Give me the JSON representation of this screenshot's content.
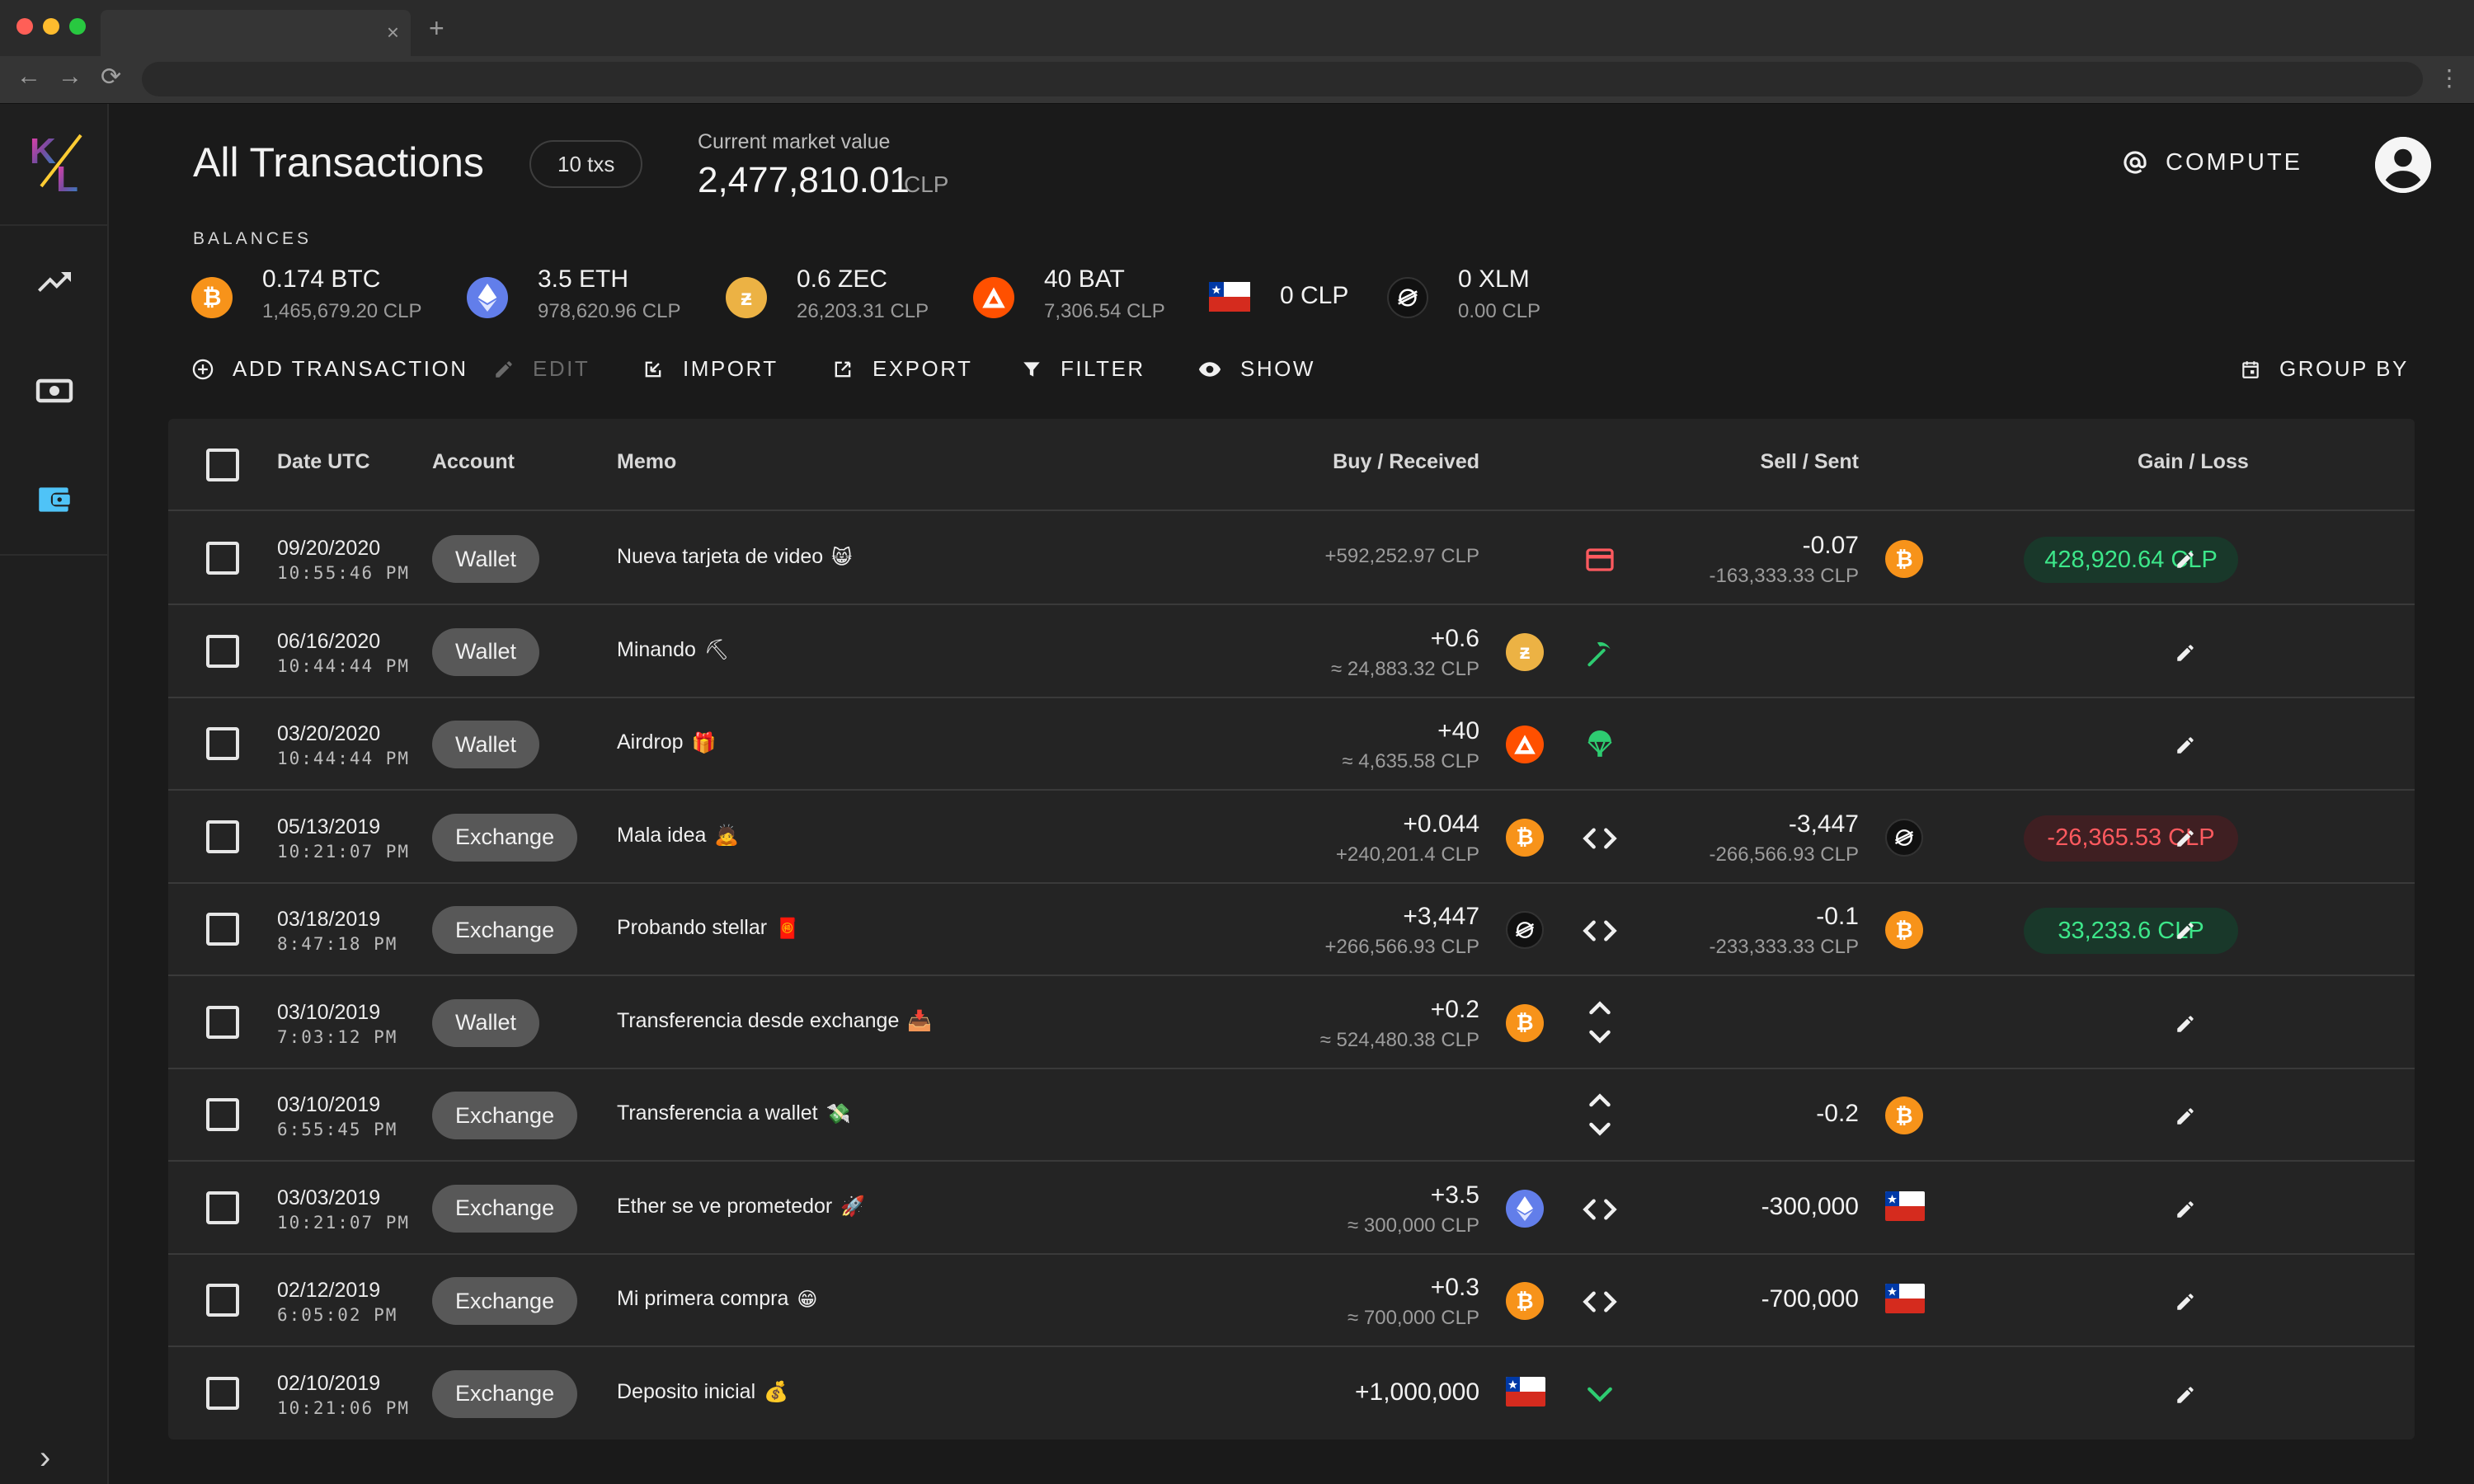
{
  "browser": {
    "tab_close": "×",
    "new_tab": "+",
    "back": "←",
    "forward": "→",
    "reload": "⟳",
    "menu": "⋮"
  },
  "sidebar": {
    "logo_letters": [
      "K",
      "L"
    ],
    "items": [
      {
        "name": "trending-icon"
      },
      {
        "name": "cash-icon"
      },
      {
        "name": "wallet-icon",
        "active_color": "#4fc3f7"
      }
    ],
    "expand": "›"
  },
  "header": {
    "title": "All Transactions",
    "tx_count": "10 txs",
    "market_value_label": "Current market value",
    "market_value": "2,477,810.01",
    "market_value_currency": "CLP",
    "compute_label": "COMPUTE"
  },
  "balances": {
    "label": "BALANCES",
    "items": [
      {
        "asset": "btc",
        "amount": "0.174 BTC",
        "value": "1,465,679.20 CLP"
      },
      {
        "asset": "eth",
        "amount": "3.5 ETH",
        "value": "978,620.96 CLP"
      },
      {
        "asset": "zec",
        "amount": "0.6 ZEC",
        "value": "26,203.31 CLP"
      },
      {
        "asset": "bat",
        "amount": "40 BAT",
        "value": "7,306.54 CLP"
      },
      {
        "asset": "clp",
        "amount": "0 CLP",
        "value": ""
      },
      {
        "asset": "xlm",
        "amount": "0 XLM",
        "value": "0.00 CLP"
      }
    ]
  },
  "toolbar": {
    "add": "ADD TRANSACTION",
    "edit": "EDIT",
    "import": "IMPORT",
    "export": "EXPORT",
    "filter": "FILTER",
    "show": "SHOW",
    "group_by": "GROUP BY"
  },
  "table": {
    "columns": {
      "date": "Date UTC",
      "account": "Account",
      "memo": "Memo",
      "buy": "Buy / Received",
      "sell": "Sell / Sent",
      "gain": "Gain / Loss"
    },
    "rows": [
      {
        "date": "09/20/2020",
        "time": "10:55:46 PM",
        "account": "Wallet",
        "memo": "Nueva tarjeta de video",
        "emoji": "😸",
        "buy_main": "",
        "buy_sub": "+592,252.97 CLP",
        "buy_asset": "",
        "kind": "card",
        "sell_main": "-0.07",
        "sell_sub": "-163,333.33 CLP",
        "sell_asset": "btc",
        "gain": "428,920.64 CLP",
        "gain_type": "pos"
      },
      {
        "date": "06/16/2020",
        "time": "10:44:44 PM",
        "account": "Wallet",
        "memo": "Minando",
        "emoji": "⛏",
        "buy_main": "+0.6",
        "buy_sub": "≈ 24,883.32 CLP",
        "buy_asset": "zec",
        "kind": "mining",
        "sell_main": "",
        "sell_sub": "",
        "sell_asset": "",
        "gain": "",
        "gain_type": ""
      },
      {
        "date": "03/20/2020",
        "time": "10:44:44 PM",
        "account": "Wallet",
        "memo": "Airdrop",
        "emoji": "🎁",
        "buy_main": "+40",
        "buy_sub": "≈ 4,635.58 CLP",
        "buy_asset": "bat",
        "kind": "airdrop",
        "sell_main": "",
        "sell_sub": "",
        "sell_asset": "",
        "gain": "",
        "gain_type": ""
      },
      {
        "date": "05/13/2019",
        "time": "10:21:07 PM",
        "account": "Exchange",
        "memo": "Mala idea",
        "emoji": "🙇",
        "buy_main": "+0.044",
        "buy_sub": "+240,201.4 CLP",
        "buy_asset": "btc",
        "kind": "trade",
        "sell_main": "-3,447",
        "sell_sub": "-266,566.93 CLP",
        "sell_asset": "xlm",
        "gain": "-26,365.53 CLP",
        "gain_type": "neg"
      },
      {
        "date": "03/18/2019",
        "time": "8:47:18 PM",
        "account": "Exchange",
        "memo": "Probando stellar",
        "emoji": "🧧",
        "buy_main": "+3,447",
        "buy_sub": "+266,566.93 CLP",
        "buy_asset": "xlm",
        "kind": "trade",
        "sell_main": "-0.1",
        "sell_sub": "-233,333.33 CLP",
        "sell_asset": "btc",
        "gain": "33,233.6 CLP",
        "gain_type": "pos"
      },
      {
        "date": "03/10/2019",
        "time": "7:03:12 PM",
        "account": "Wallet",
        "memo": "Transferencia desde exchange",
        "emoji": "📥",
        "buy_main": "+0.2",
        "buy_sub": "≈ 524,480.38 CLP",
        "buy_asset": "btc",
        "kind": "transfer",
        "sell_main": "",
        "sell_sub": "",
        "sell_asset": "",
        "gain": "",
        "gain_type": ""
      },
      {
        "date": "03/10/2019",
        "time": "6:55:45 PM",
        "account": "Exchange",
        "memo": "Transferencia a wallet",
        "emoji": "💸",
        "buy_main": "",
        "buy_sub": "",
        "buy_asset": "",
        "kind": "transfer",
        "sell_main": "-0.2",
        "sell_sub": "",
        "sell_asset": "btc",
        "gain": "",
        "gain_type": ""
      },
      {
        "date": "03/03/2019",
        "time": "10:21:07 PM",
        "account": "Exchange",
        "memo": "Ether se ve prometedor",
        "emoji": "🚀",
        "buy_main": "+3.5",
        "buy_sub": "≈ 300,000 CLP",
        "buy_asset": "eth",
        "kind": "trade",
        "sell_main": "-300,000",
        "sell_sub": "",
        "sell_asset": "clp",
        "gain": "",
        "gain_type": ""
      },
      {
        "date": "02/12/2019",
        "time": "6:05:02 PM",
        "account": "Exchange",
        "memo": "Mi primera compra",
        "emoji": "😁",
        "buy_main": "+0.3",
        "buy_sub": "≈ 700,000 CLP",
        "buy_asset": "btc",
        "kind": "trade",
        "sell_main": "-700,000",
        "sell_sub": "",
        "sell_asset": "clp",
        "gain": "",
        "gain_type": ""
      },
      {
        "date": "02/10/2019",
        "time": "10:21:06 PM",
        "account": "Exchange",
        "memo": "Deposito inicial",
        "emoji": "💰",
        "buy_main": "+1,000,000",
        "buy_sub": "",
        "buy_asset": "clp",
        "kind": "deposit",
        "sell_main": "",
        "sell_sub": "",
        "sell_asset": "",
        "gain": "",
        "gain_type": ""
      }
    ]
  },
  "colors": {
    "background": "#1a1a1a",
    "table_bg": "#242424",
    "gain_positive": "#3de78a",
    "gain_negative": "#ff5a5f",
    "kind_green": "#2ecc71",
    "card_red": "#ff5a5f",
    "btc": "#f7931a",
    "eth": "#627eea",
    "zec": "#ecb244",
    "bat": "#ff5000"
  }
}
